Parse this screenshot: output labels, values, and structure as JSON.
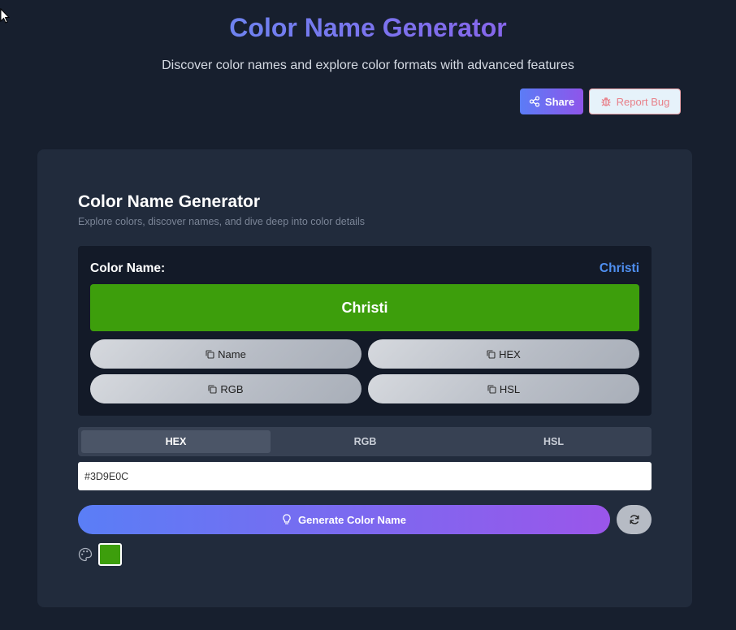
{
  "header": {
    "title": "Color Name Generator",
    "subtitle": "Discover color names and explore color formats with advanced features",
    "share_label": "Share",
    "report_bug_label": "Report Bug"
  },
  "card": {
    "title": "Color Name Generator",
    "subtitle": "Explore colors, discover names, and dive deep into color details"
  },
  "result": {
    "label": "Color Name:",
    "name": "Christi",
    "swatch_text": "Christi",
    "color": "#3D9E0C",
    "copy_buttons": [
      "Name",
      "HEX",
      "RGB",
      "HSL"
    ]
  },
  "format_tabs": [
    {
      "label": "HEX",
      "active": true
    },
    {
      "label": "RGB",
      "active": false
    },
    {
      "label": "HSL",
      "active": false
    }
  ],
  "input": {
    "value": "#3D9E0C"
  },
  "actions": {
    "generate_label": "Generate Color Name"
  },
  "icons": [
    "cursor-icon",
    "share-icon",
    "bug-icon",
    "copy-icon",
    "lightbulb-icon",
    "refresh-icon",
    "palette-icon"
  ],
  "colors": {
    "accent_start": "#5b7cf6",
    "accent_end": "#9a56ea",
    "name_highlight": "#4f8ff0",
    "selected_color": "#3d9e0c"
  }
}
